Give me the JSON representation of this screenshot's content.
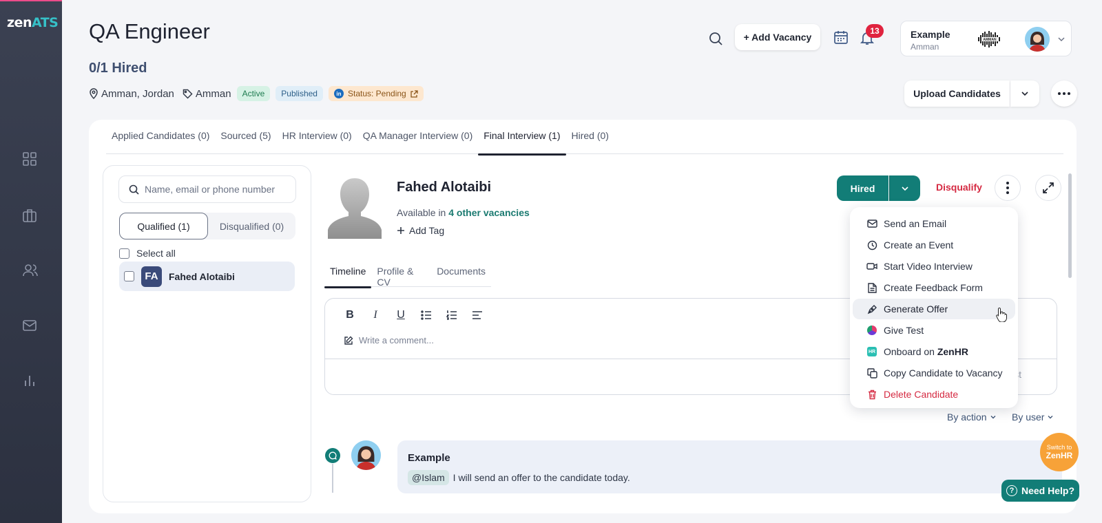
{
  "app": {
    "logo_main": "zen",
    "logo_accent": "ATS"
  },
  "sidebar": {
    "items": [
      {
        "icon": "dashboard-grid-icon"
      },
      {
        "icon": "briefcase-icon"
      },
      {
        "icon": "users-icon"
      },
      {
        "icon": "mail-icon"
      },
      {
        "icon": "bar-chart-icon"
      }
    ]
  },
  "header": {
    "title": "QA Engineer",
    "hired_count": "0/1 Hired",
    "location": "Amman, Jordan",
    "tag": "Amman",
    "status_active": "Active",
    "status_published": "Published",
    "status_pending": "Status: Pending",
    "linkedin_badge": "in",
    "add_vacancy": "+ Add Vacancy",
    "notifications_count": "13",
    "company_name": "Example",
    "company_city": "Amman",
    "upload_candidates": "Upload Candidates"
  },
  "stages": [
    {
      "label": "Applied Candidates (0)"
    },
    {
      "label": "Sourced (5)"
    },
    {
      "label": "HR Interview (0)"
    },
    {
      "label": "QA Manager Interview (0)"
    },
    {
      "label": "Final Interview (1)"
    },
    {
      "label": "Hired (0)"
    }
  ],
  "candidate_list": {
    "search_placeholder": "Name, email or phone number",
    "qualified": "Qualified (1)",
    "disqualified": "Disqualified (0)",
    "select_all": "Select all",
    "rows": [
      {
        "initials": "FA",
        "name": "Fahed Alotaibi"
      }
    ]
  },
  "candidate": {
    "name": "Fahed Alotaibi",
    "available_prefix": "Available in",
    "available_link": "4 other vacancies",
    "add_tag": "Add Tag",
    "stage_button": "Hired",
    "disqualify": "Disqualify",
    "tabs": [
      "Timeline",
      "Profile & CV",
      "Documents"
    ]
  },
  "editor": {
    "placeholder": "Write a comment...",
    "post": "Post",
    "tools": [
      "B",
      "I",
      "U"
    ]
  },
  "actions_menu": {
    "items": [
      {
        "label": "Send an Email",
        "icon": "mail-icon"
      },
      {
        "label": "Create an Event",
        "icon": "clock-icon"
      },
      {
        "label": "Start Video Interview",
        "icon": "video-icon"
      },
      {
        "label": "Create Feedback Form",
        "icon": "document-icon"
      },
      {
        "label": "Generate Offer",
        "icon": "pen-nib-icon"
      },
      {
        "label": "Give Test",
        "icon": "test-logo-icon"
      },
      {
        "label": "Onboard on",
        "label_bold": "ZenHR",
        "icon": "zenhr-badge-icon",
        "icon_text": "HR"
      },
      {
        "label": "Copy Candidate to Vacancy",
        "icon": "copy-icon"
      },
      {
        "label": "Delete Candidate",
        "icon": "trash-icon"
      }
    ]
  },
  "timeline": {
    "filter_action": "By action",
    "filter_user": "By user",
    "entries": [
      {
        "author": "Example",
        "mention": "@Islam",
        "message": "I will send an offer to the candidate today."
      }
    ]
  },
  "floating": {
    "switch_line1": "Switch to",
    "switch_line2": "ZenHR",
    "need_help": "Need Help?"
  },
  "colors": {
    "primary_teal": "#127d77",
    "danger": "#d52a42",
    "sidebar": "#353a4a",
    "badge_red": "#e0233f",
    "orange": "#f7a238"
  }
}
